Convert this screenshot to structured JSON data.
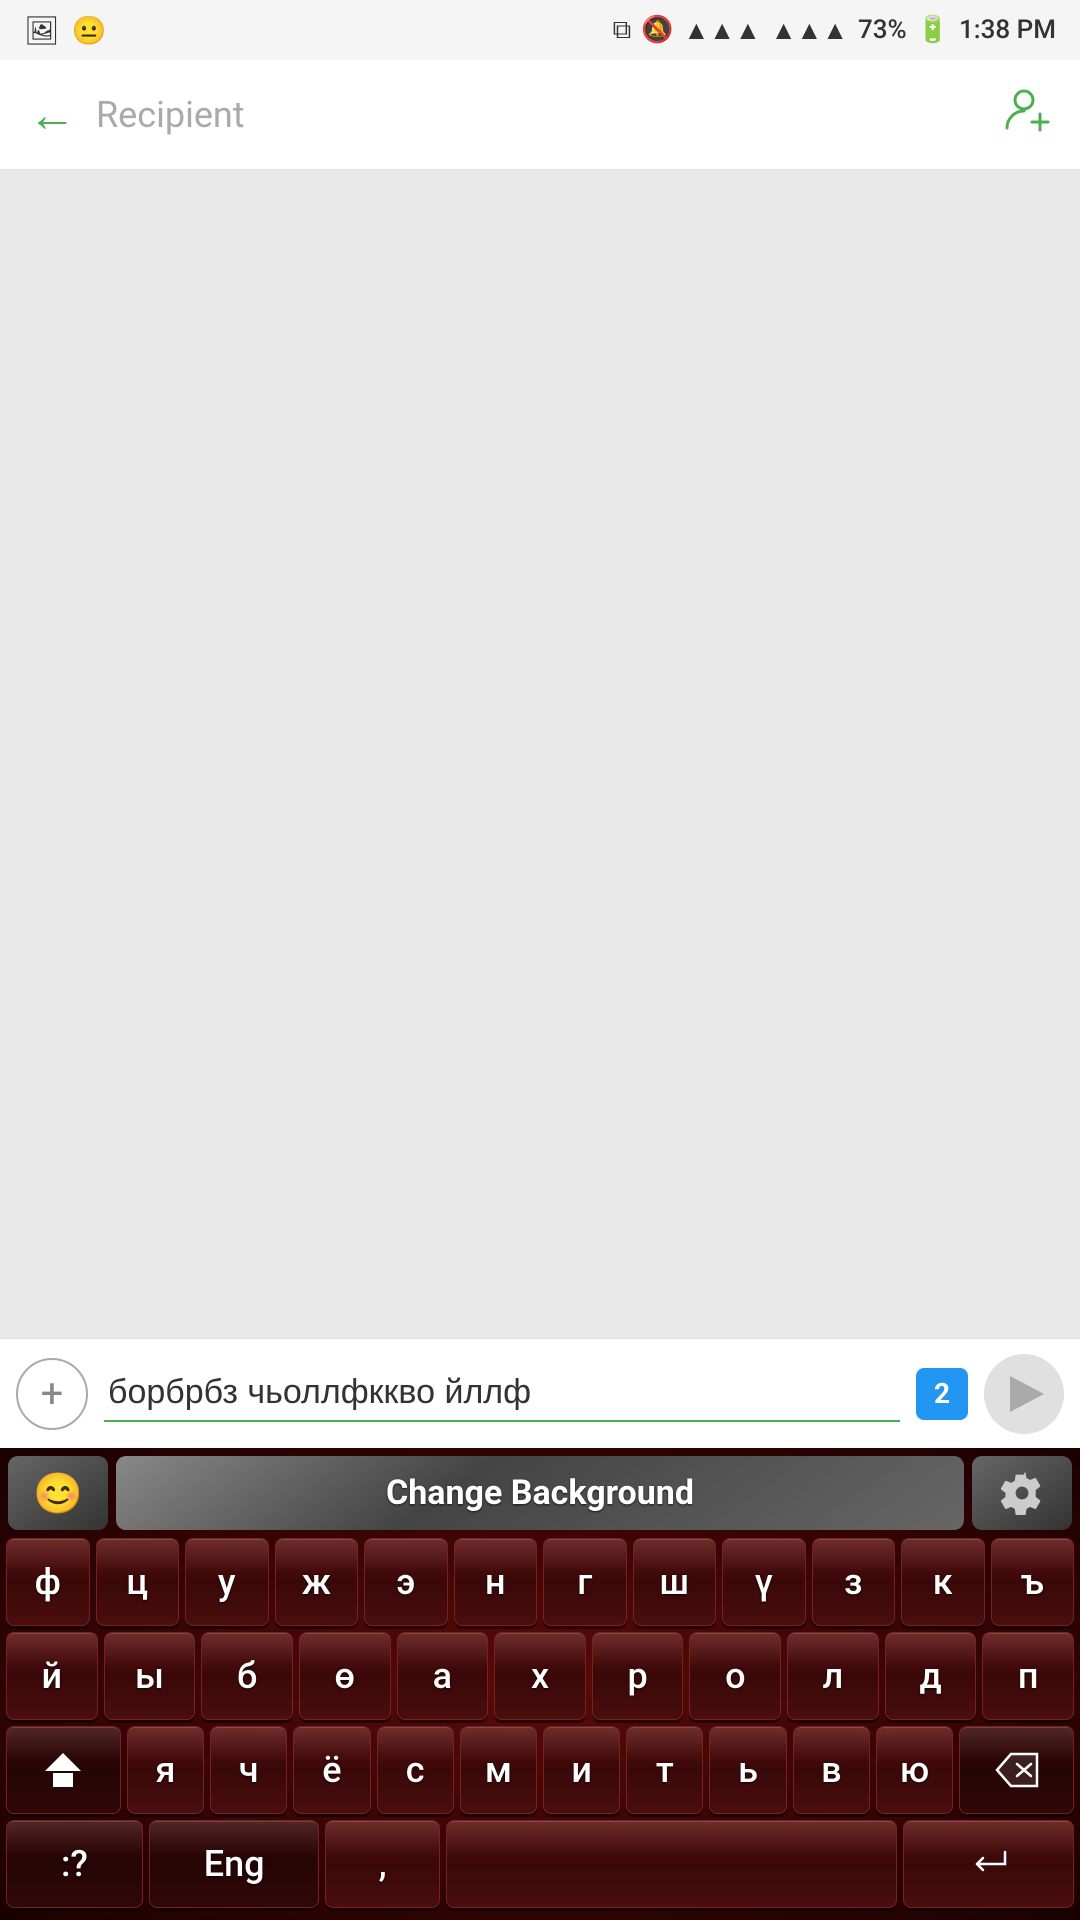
{
  "statusBar": {
    "time": "1:38 PM",
    "battery": "73%",
    "signal1": "▲▲▲",
    "signal2": "▲▲▲"
  },
  "header": {
    "back_label": "←",
    "recipient_placeholder": "Recipient",
    "add_contact_label": "👤+"
  },
  "inputBar": {
    "add_label": "+",
    "message_text": "борбрбз чьоллфккво йллф",
    "badge_count": "2",
    "send_label": "▶"
  },
  "keyboard": {
    "emoji_label": "😊",
    "change_background_label": "Change Background",
    "settings_label": "⚙",
    "row1": [
      "ф",
      "ц",
      "у",
      "ж",
      "э",
      "н",
      "г",
      "ш",
      "ү",
      "з",
      "к",
      "ъ"
    ],
    "row2": [
      "й",
      "ы",
      "б",
      "ө",
      "а",
      "х",
      "р",
      "о",
      "л",
      "д",
      "п"
    ],
    "row3_special_left": "⬆",
    "row3": [
      "я",
      "ч",
      "ё",
      "с",
      "м",
      "и",
      "т",
      "ь",
      "в",
      "ю"
    ],
    "row3_special_right": "⌫",
    "bottom_row": [
      ":?",
      "Eng",
      ",",
      " ",
      "↵"
    ]
  }
}
